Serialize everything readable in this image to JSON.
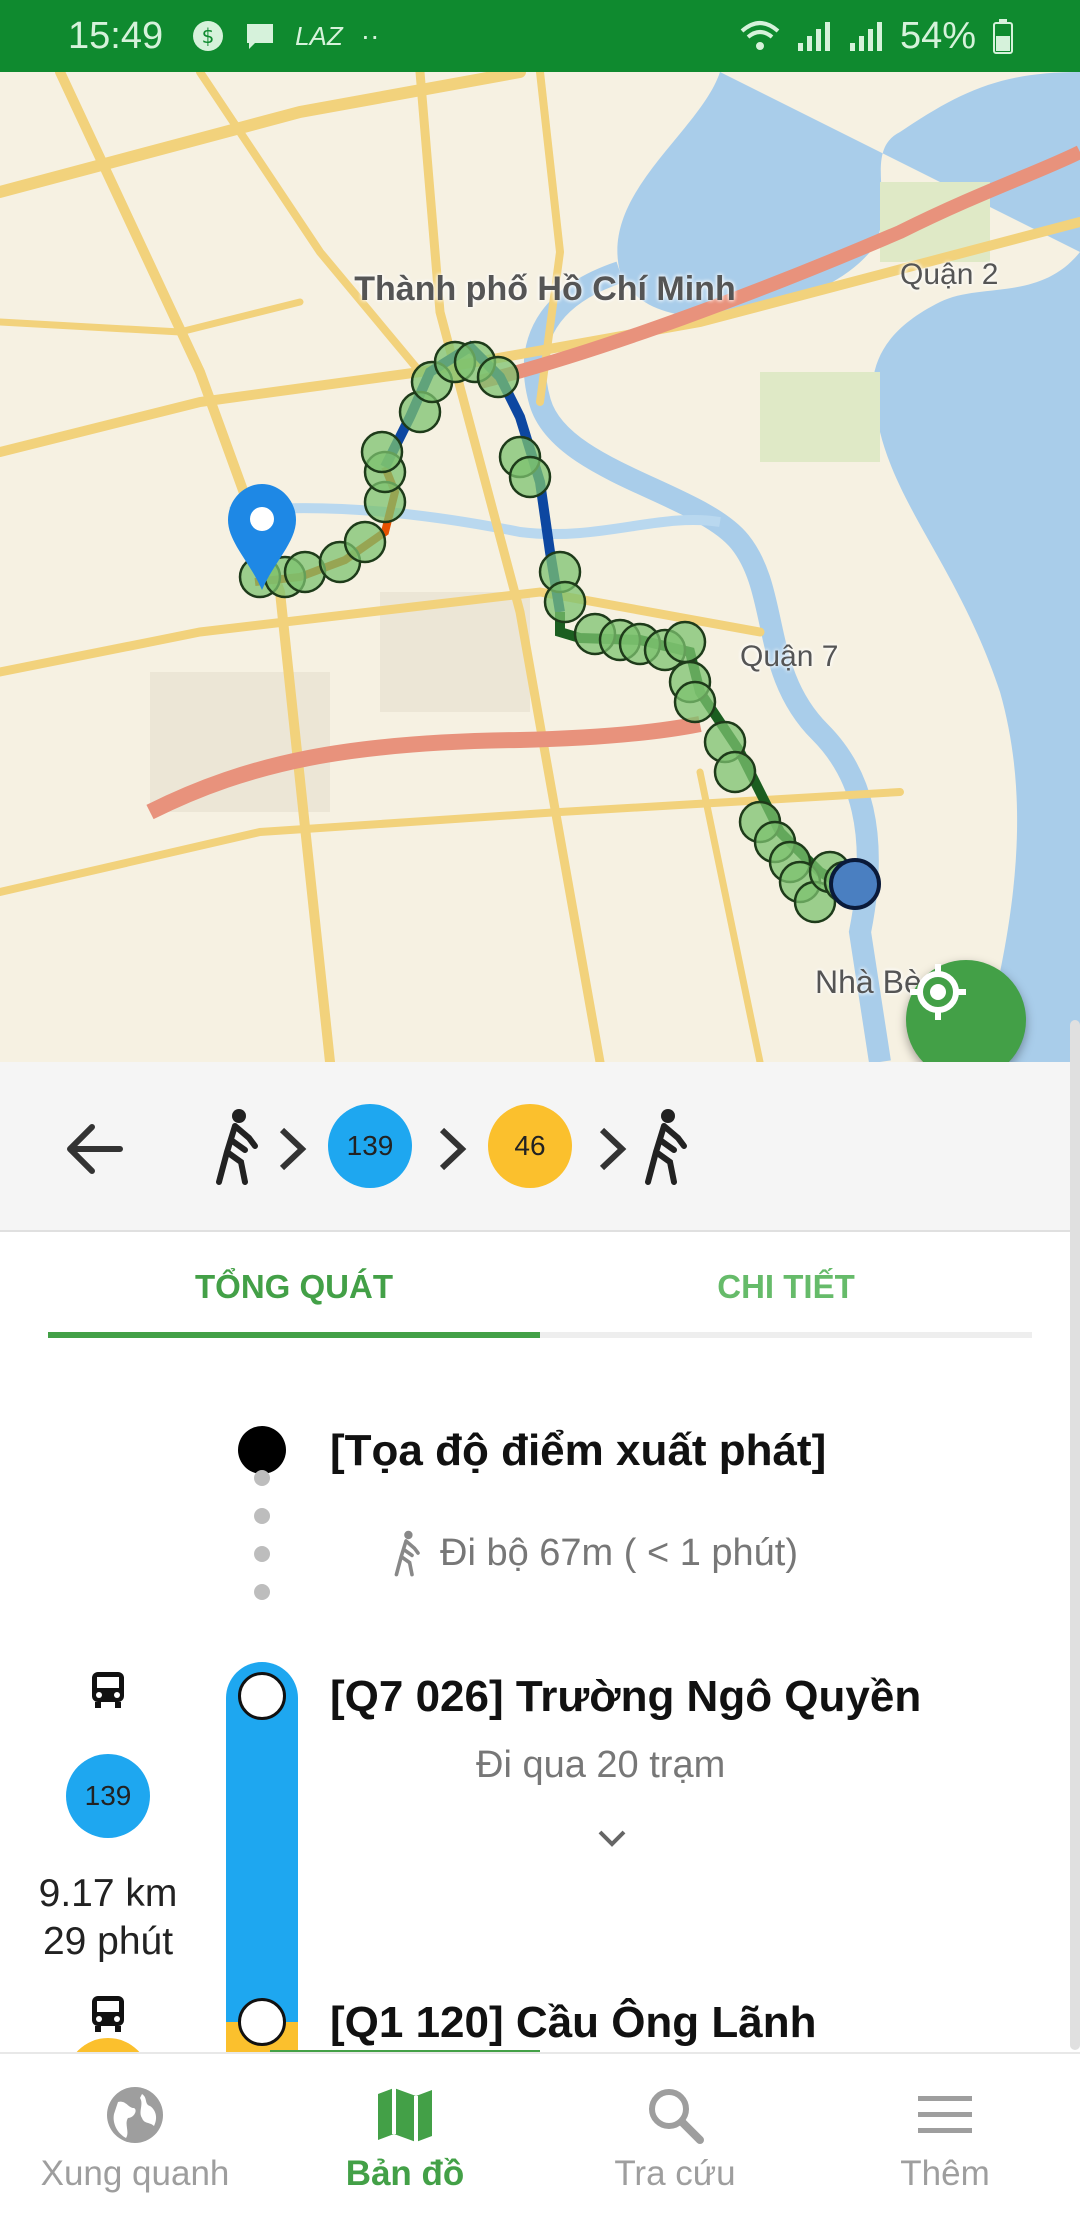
{
  "status_bar": {
    "time": "15:49",
    "carrier_text": "LAZ",
    "battery": "54%"
  },
  "map": {
    "labels": {
      "city": "Thành phố Hồ Chí Minh",
      "district2": "Quận 2",
      "district7": "Quận 7",
      "nhabe": "Nhà Bè"
    },
    "route_colors": {
      "walk": "#e65100",
      "bus_139": "#0d47a1",
      "bus_46": "#1b5e20",
      "stop_marker": "#66bb6a",
      "pin": "#1e88e5"
    }
  },
  "route_summary": {
    "segments": [
      "walk",
      "bus",
      "bus",
      "walk"
    ],
    "bus_1": {
      "number": "139",
      "color": "#1ea7f0"
    },
    "bus_2": {
      "number": "46",
      "color": "#fbc02d"
    }
  },
  "tabs": {
    "overview": "TỔNG QUÁT",
    "detail": "CHI TIẾT",
    "active_color": "#43a047",
    "inactive_color": "#66bb6a"
  },
  "timeline": {
    "start_point": "[Tọa độ điểm xuất phát]",
    "walk_info": "Đi bộ 67m ( < 1 phút)",
    "stop_1": "[Q7 026] Trường Ngô Quyền",
    "passes": "Đi qua 20 trạm",
    "stop_2": "[Q1 120] Cầu Ông Lãnh",
    "bus_1_badge": "139",
    "bus_1_distance": "9.17 km",
    "bus_1_time": "29 phút"
  },
  "bottom_nav": {
    "nearby": "Xung quanh",
    "map": "Bản đồ",
    "search": "Tra cứu",
    "more": "Thêm",
    "active_color": "#43a047",
    "inactive_color": "#9e9e9e"
  }
}
